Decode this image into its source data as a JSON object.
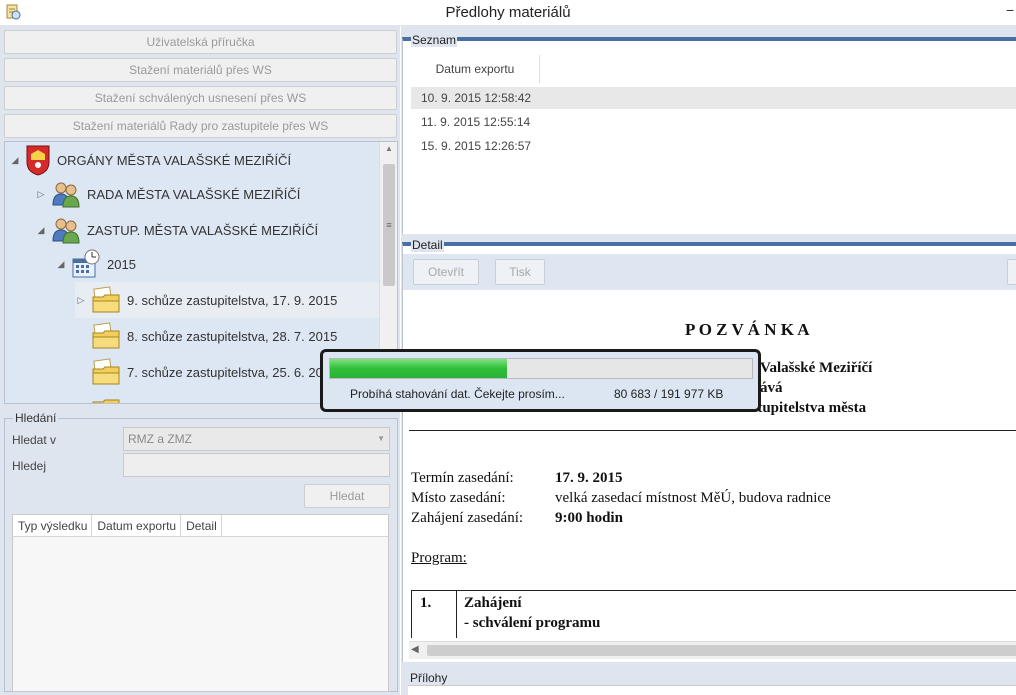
{
  "window": {
    "title": "Předlohy materiálů",
    "minimize_glyph": "−"
  },
  "left": {
    "buttons": [
      "Uživatelská příručka",
      "Stažení materiálů přes WS",
      "Stažení schválených usnesení přes WS",
      "Stažení materiálů Rady pro zastupitele přes WS"
    ],
    "tree": [
      {
        "label": "ORGÁNY MĚSTA VALAŠSKÉ MEZIŘÍČÍ",
        "icon": "city-coat-of-arms-icon",
        "arrow": "◢"
      },
      {
        "label": "RADA MĚSTA VALAŠSKÉ MEZIŘÍČÍ",
        "icon": "group-users-icon",
        "arrow": "▷"
      },
      {
        "label": "ZASTUP. MĚSTA VALAŠSKÉ MEZIŘÍČÍ",
        "icon": "group-users-icon",
        "arrow": "◢"
      },
      {
        "label": "2015",
        "icon": "calendar-clock-icon",
        "arrow": "◢"
      },
      {
        "label": "9. schůze zastupitelstva, 17. 9. 2015",
        "icon": "folder-documents-icon",
        "arrow": "▷"
      },
      {
        "label": "8. schůze zastupitelstva, 28. 7. 2015",
        "icon": "folder-documents-icon",
        "arrow": ""
      },
      {
        "label": "7. schůze zastupitelstva, 25. 6. 2015",
        "icon": "folder-documents-icon",
        "arrow": ""
      }
    ],
    "search": {
      "group_label": "Hledání",
      "hledat_v_label": "Hledat v",
      "hledat_v_value": "RMZ a ZMZ",
      "hledej_label": "Hledej",
      "hledej_value": "",
      "button": "Hledat",
      "columns": [
        "Typ výsledku",
        "Datum exportu",
        "Detail"
      ]
    }
  },
  "seznam": {
    "group_label": "Seznam",
    "column": "Datum exportu",
    "rows": [
      "10. 9. 2015 12:58:42",
      "11. 9. 2015 12:55:14",
      "15. 9. 2015 12:26:57"
    ]
  },
  "detail": {
    "group_label": "Detail",
    "open_button": "Otevřít",
    "print_button": "Tisk",
    "document": {
      "heading": "P O Z V Á N K A",
      "line1": "Valašské Meziříčí",
      "line2": "ává",
      "line3": "9. řádné zasedání Zastupitelstva města",
      "termin_label": "Termín zasedání:",
      "termin_value": "17. 9. 2015",
      "misto_label": "Místo zasedání:",
      "misto_value": "velká zasedací místnost MěÚ, budova radnice",
      "zahajeni_label": "Zahájení zasedání:",
      "zahajeni_value": "9:00 hodin",
      "program_label": "Program:",
      "item_number": "1.",
      "item_title": "Zahájení",
      "item_sub": "- schválení programu"
    }
  },
  "attachments": {
    "group_label": "Přílohy"
  },
  "progress": {
    "message": "Probíhá stahování dat. Čekejte prosím...",
    "size_text": "80 683 / 191 977 KB",
    "fraction": 0.42
  }
}
